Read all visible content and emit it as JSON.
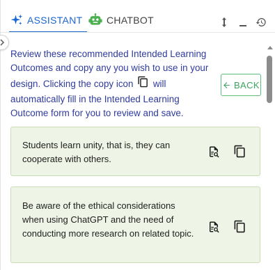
{
  "tabs": [
    {
      "label": "ASSISTANT",
      "icon": "sparkle-icon",
      "active": true
    },
    {
      "label": "CHATBOT",
      "icon": "robot-icon",
      "active": false
    }
  ],
  "header_actions": [
    "resize-vertical-icon",
    "minimize-icon",
    "history-icon"
  ],
  "intro": {
    "text_before": "Review these recommended Intended Learning Outcomes and copy any you wish to use in your design. Clicking the copy icon",
    "text_after": "will automatically fill in the Intended Learning Outcome form for you to review and save."
  },
  "back_button": {
    "label": "BACK",
    "icon": "arrow-left-icon"
  },
  "outcomes": [
    {
      "text": "Students learn unity, that is, they can cooperate with others."
    },
    {
      "text": "Be aware of the ethical considerations when using ChatGPT and the need of conducting more research on related topic."
    }
  ],
  "colors": {
    "accent": "#1a66d2",
    "intro_text": "#2e3a9e",
    "back_green": "#3aa55d",
    "card_bg": "#eff5e6",
    "card_border": "#c9dcb3"
  }
}
